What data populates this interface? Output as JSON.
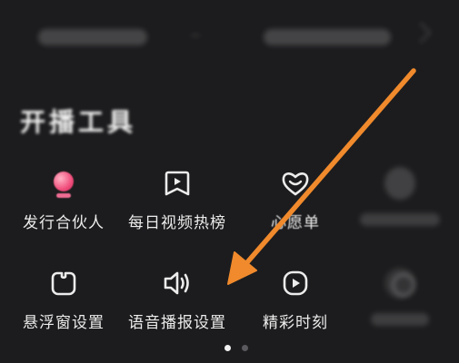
{
  "section": {
    "title": "开播工具"
  },
  "tools": [
    {
      "label": "发行合伙人",
      "icon": "pink-ball-icon"
    },
    {
      "label": "每日视频热榜",
      "icon": "play-bookmark-icon"
    },
    {
      "label": "心愿单",
      "icon": "heart-icon"
    },
    {
      "label": "",
      "icon": "blurred-circle-icon"
    },
    {
      "label": "悬浮窗设置",
      "icon": "floating-window-icon"
    },
    {
      "label": "语音播报设置",
      "icon": "speaker-icon"
    },
    {
      "label": "精彩时刻",
      "icon": "play-circle-icon"
    },
    {
      "label": "",
      "icon": "blurred-moon-icon"
    }
  ],
  "pagination": {
    "pages": 2,
    "current": 1
  },
  "colors": {
    "background": "#1c1c1e",
    "annotation_arrow": "#f08a2c",
    "accent_pink": "#f04d7b"
  }
}
